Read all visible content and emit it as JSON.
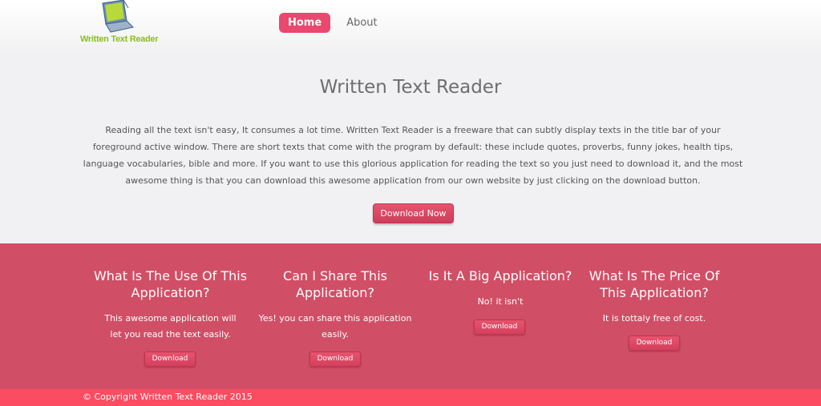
{
  "logo": {
    "text": "Written Text Reader"
  },
  "nav": {
    "items": [
      {
        "label": "Home"
      },
      {
        "label": "About"
      }
    ]
  },
  "hero": {
    "title": "Written Text Reader",
    "description": "Reading all the text isn't easy, It consumes a lot time. Written Text Reader is a freeware that can subtly display texts in the title bar of your foreground active window. There are short texts that come with the program by default: these include quotes, proverbs, funny jokes, health tips, language vocabularies, bible and more. If you want to use this glorious application for reading the text so you just need to download it, and the most awesome thing is that you can download this awesome application from our own website by just clicking on the download button.",
    "button": "Download Now"
  },
  "features": [
    {
      "title": "What Is The Use Of This Application?",
      "text": "This awesome application will let you read the text easily.",
      "button": "Download"
    },
    {
      "title": "Can I Share This Application?",
      "text": "Yes! you can share this application easily.",
      "button": "Download"
    },
    {
      "title": "Is It A Big Application?",
      "text": "No! it isn't",
      "button": "Download"
    },
    {
      "title": "What Is The Price Of This Application?",
      "text": "It is tottaly free of cost.",
      "button": "Download"
    }
  ],
  "footer": {
    "copyright": "© Copyright Written Text Reader 2015"
  },
  "colors": {
    "accent": "#e9496f",
    "features_bg": "#d04f66",
    "footer_bg": "#fc4c62",
    "logo_text": "#8bbd23"
  }
}
